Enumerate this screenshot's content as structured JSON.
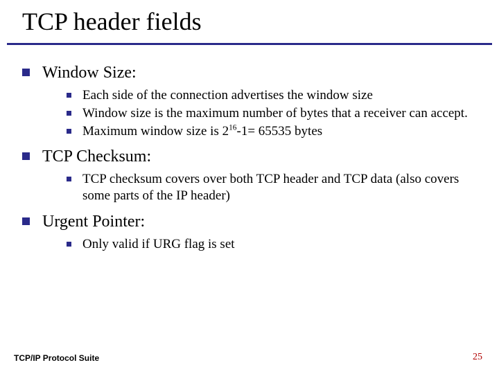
{
  "title": "TCP header fields",
  "sections": [
    {
      "heading": "Window Size:",
      "items": [
        "Each side of the connection advertises the window size",
        "Window size is the maximum number of bytes that a receiver can accept.",
        "Maximum window size is 2^16-1= 65535 bytes"
      ]
    },
    {
      "heading": "TCP Checksum:",
      "items": [
        "TCP checksum covers over both TCP header and TCP data (also covers some parts of the IP header)"
      ]
    },
    {
      "heading": "Urgent Pointer:",
      "items": [
        "Only valid if URG flag is set"
      ]
    }
  ],
  "footer_left": "TCP/IP Protocol Suite",
  "footer_right": "25",
  "colors": {
    "accent": "#2a2a8a",
    "page_number": "#b00000"
  }
}
